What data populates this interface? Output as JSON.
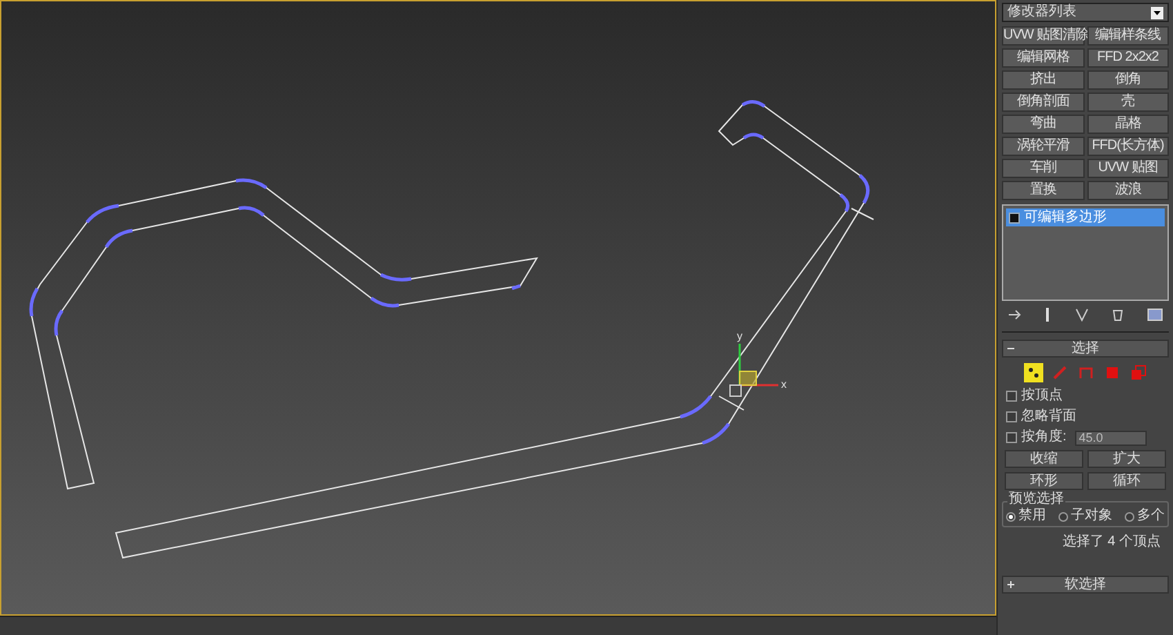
{
  "modifier_list": {
    "label": "修改器列表"
  },
  "modifier_buttons": [
    {
      "label": "UVW 贴图清除"
    },
    {
      "label": "编辑样条线"
    },
    {
      "label": "编辑网格"
    },
    {
      "label": "FFD 2x2x2"
    },
    {
      "label": "挤出"
    },
    {
      "label": "倒角"
    },
    {
      "label": "倒角剖面"
    },
    {
      "label": "壳"
    },
    {
      "label": "弯曲"
    },
    {
      "label": "晶格"
    },
    {
      "label": "涡轮平滑"
    },
    {
      "label": "FFD(长方体)"
    },
    {
      "label": "车削"
    },
    {
      "label": "UVW 贴图"
    },
    {
      "label": "置换"
    },
    {
      "label": "波浪"
    }
  ],
  "modifier_stack": [
    {
      "label": "可编辑多边形",
      "selected": true
    }
  ],
  "gizmo": {
    "x_label": "x",
    "y_label": "y"
  },
  "selection_rollout": {
    "title": "选择",
    "expanded": true,
    "subobject_levels": [
      {
        "kind": "vertex",
        "selected": true
      },
      {
        "kind": "edge",
        "selected": false
      },
      {
        "kind": "border",
        "selected": false
      },
      {
        "kind": "polygon",
        "selected": false
      },
      {
        "kind": "element",
        "selected": false
      }
    ],
    "checkboxes": [
      {
        "label": "按顶点",
        "checked": false
      },
      {
        "label": "忽略背面",
        "checked": false
      },
      {
        "label": "按角度:",
        "checked": false,
        "value": "45.0"
      }
    ],
    "buttons": [
      {
        "label": "收缩"
      },
      {
        "label": "扩大"
      }
    ],
    "spin_buttons": [
      {
        "label": "环形"
      },
      {
        "label": "循环"
      }
    ],
    "preview": {
      "title": "预览选择",
      "options": [
        {
          "label": "禁用",
          "selected": true
        },
        {
          "label": "子对象",
          "selected": false
        },
        {
          "label": "多个",
          "selected": false
        }
      ]
    },
    "status": "选择了 4 个顶点"
  },
  "soft_selection_rollout": {
    "title": "软选择",
    "expanded": false
  }
}
